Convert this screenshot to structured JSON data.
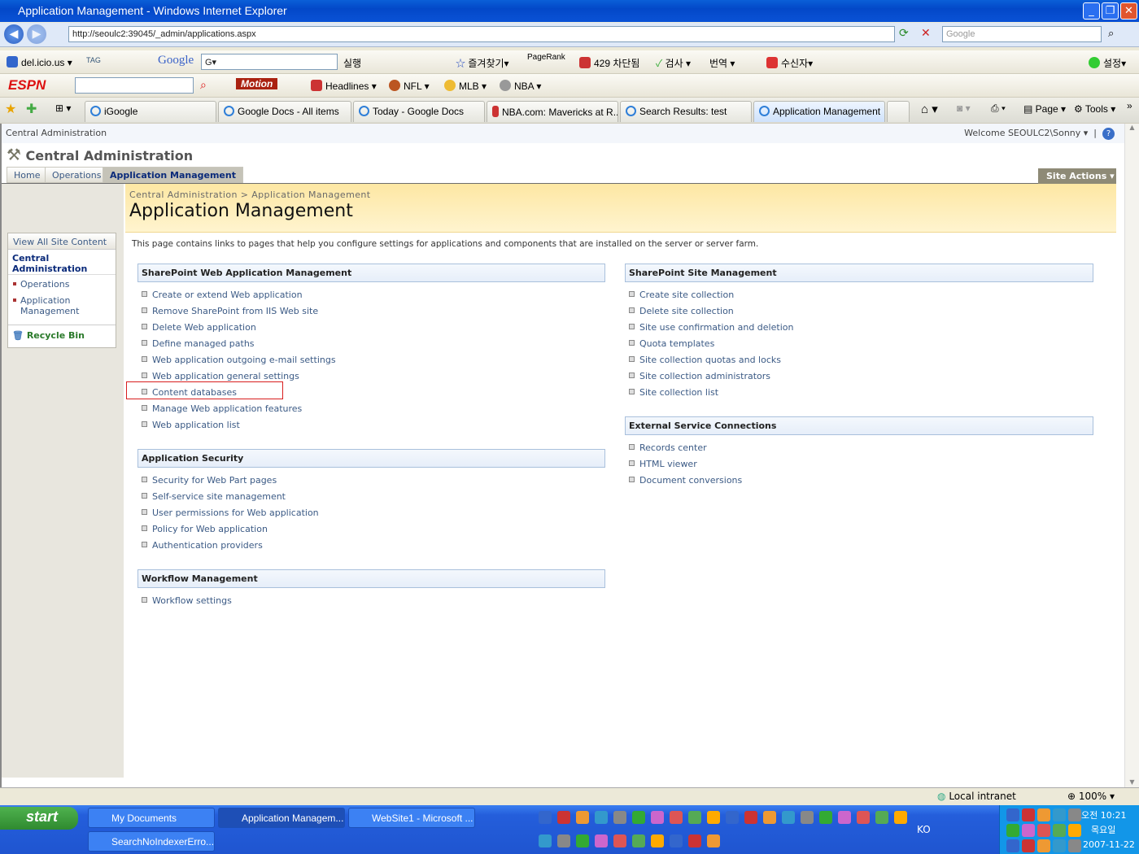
{
  "window": {
    "title": "Application Management - Windows Internet Explorer"
  },
  "address": {
    "url": "http://seoulc2:39045/_admin/applications.aspx",
    "search_placeholder": "Google"
  },
  "toolbar1": {
    "delicious": "del.icio.us",
    "tag": "TAG",
    "google": "Google",
    "run": "실행",
    "favorites": "즐겨찾기▾",
    "pagerank": "PageRank",
    "blocked": "429 차단됨",
    "check": "검사",
    "translate": "번역",
    "recipient": "수신자▾",
    "settings": "설정▾"
  },
  "toolbar2": {
    "espn": "ESPN",
    "motion": "Motion",
    "headlines": "Headlines",
    "nfl": "NFL",
    "mlb": "MLB",
    "nba": "NBA"
  },
  "tabs": [
    {
      "label": "iGoogle"
    },
    {
      "label": "Google Docs - All items"
    },
    {
      "label": "Today - Google Docs"
    },
    {
      "label": "NBA.com: Mavericks at R..."
    },
    {
      "label": "Search Results: test"
    },
    {
      "label": "Application Management"
    }
  ],
  "command_bar": {
    "page": "Page",
    "tools": "Tools"
  },
  "site": {
    "top_title": "Central Administration",
    "welcome": "Welcome SEOULC2\\Sonny ▾",
    "logo_title": "Central Administration",
    "site_actions": "Site Actions ▾",
    "top_tabs": [
      {
        "label": "Home"
      },
      {
        "label": "Operations"
      },
      {
        "label": "Application Management"
      }
    ],
    "quick_launch": {
      "view_all": "View All Site Content",
      "heading": "Central Administration",
      "items": [
        "Operations",
        "Application Management"
      ],
      "recycle_bin": "Recycle Bin"
    },
    "breadcrumb": "Central Administration > Application Management",
    "page_title": "Application Management",
    "description": "This page contains links to pages that help you configure settings for applications and components that are installed on the server or server farm.",
    "sections_left": [
      {
        "title": "SharePoint Web Application Management",
        "links": [
          "Create or extend Web application",
          "Remove SharePoint from IIS Web site",
          "Delete Web application",
          "Define managed paths",
          "Web application outgoing e-mail settings",
          "Web application general settings",
          "Content databases",
          "Manage Web application features",
          "Web application list"
        ]
      },
      {
        "title": "Application Security",
        "links": [
          "Security for Web Part pages",
          "Self-service site management",
          "User permissions for Web application",
          "Policy for Web application",
          "Authentication providers"
        ]
      },
      {
        "title": "Workflow Management",
        "links": [
          "Workflow settings"
        ]
      }
    ],
    "sections_right": [
      {
        "title": "SharePoint Site Management",
        "links": [
          "Create site collection",
          "Delete site collection",
          "Site use confirmation and deletion",
          "Quota templates",
          "Site collection quotas and locks",
          "Site collection administrators",
          "Site collection list"
        ]
      },
      {
        "title": "External Service Connections",
        "links": [
          "Records center",
          "HTML viewer",
          "Document conversions"
        ]
      }
    ]
  },
  "status": {
    "zone": "Local intranet",
    "zoom": "100%"
  },
  "taskbar": {
    "start": "start",
    "tasks": [
      "My Documents",
      "Application Managem...",
      "WebSite1 - Microsoft ...",
      "SearchNoIndexerErro..."
    ],
    "lang": "KO",
    "time": "오전 10:21",
    "day": "목요일",
    "date": "2007-11-22"
  }
}
